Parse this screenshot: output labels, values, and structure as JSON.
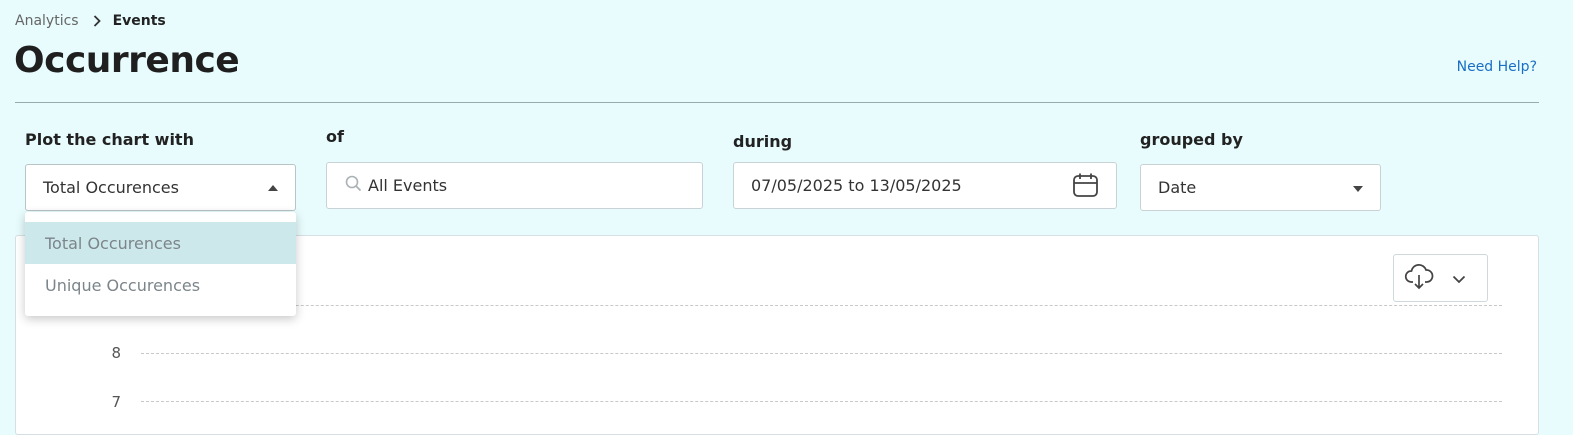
{
  "breadcrumb": {
    "parent": "Analytics",
    "current": "Events"
  },
  "page": {
    "title": "Occurrence",
    "help_link": "Need Help?"
  },
  "filters": {
    "plot": {
      "label": "Plot the chart with",
      "value": "Total Occurences",
      "options": [
        "Total Occurences",
        "Unique Occurences"
      ],
      "highlighted": "Total Occurences"
    },
    "of": {
      "label": "of",
      "value": "All Events"
    },
    "during": {
      "label": "during",
      "value": "07/05/2025 to 13/05/2025"
    },
    "grouped_by": {
      "label": "grouped by",
      "value": "Date"
    }
  },
  "chart": {
    "y_ticks": [
      "8",
      "7"
    ]
  },
  "colors": {
    "background": "#e8fcfd",
    "link": "#1a6fc4",
    "option_selected": "#cde8ea"
  },
  "icons": {
    "breadcrumb_separator": "chevron-right-icon",
    "search": "search-icon",
    "calendar": "calendar-icon",
    "download": "cloud-download-icon",
    "download_menu": "chevron-down-icon"
  }
}
